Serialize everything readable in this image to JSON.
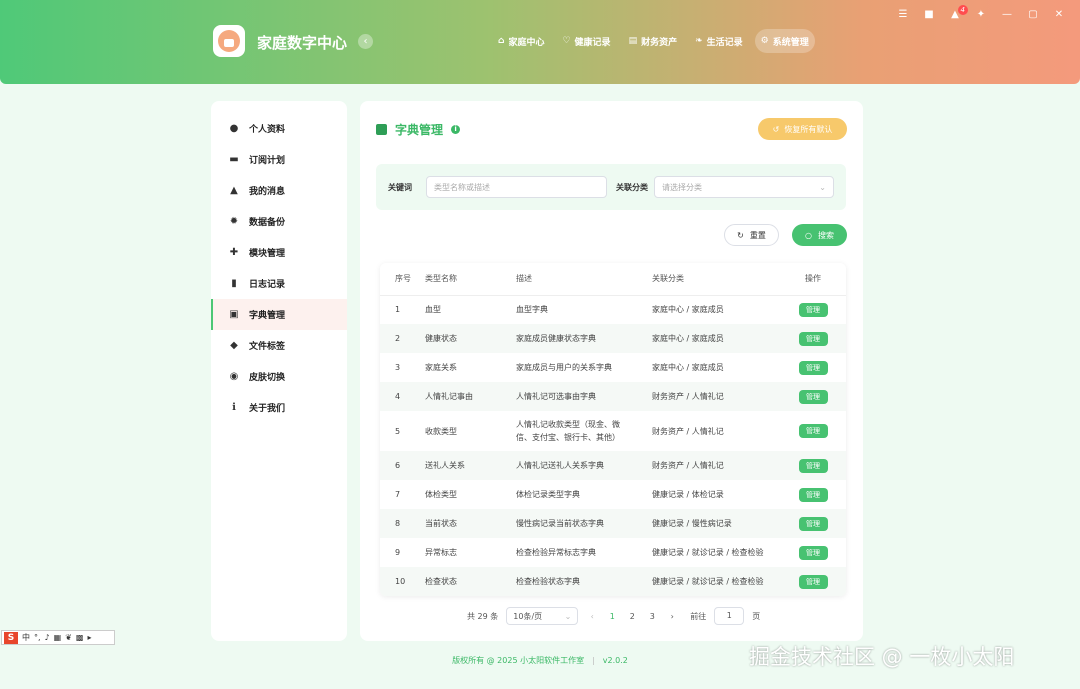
{
  "app": {
    "title": "家庭数字中心",
    "collapse_icon": "‹"
  },
  "nav": [
    {
      "label": "家庭中心",
      "icon": "home-icon"
    },
    {
      "label": "健康记录",
      "icon": "heart-icon"
    },
    {
      "label": "财务资产",
      "icon": "wallet-icon"
    },
    {
      "label": "生活记录",
      "icon": "leaf-icon"
    },
    {
      "label": "系统管理",
      "icon": "gears-icon",
      "active": true
    }
  ],
  "window": {
    "notification_count": "4"
  },
  "sidebar": [
    {
      "label": "个人资料",
      "icon": "user-icon"
    },
    {
      "label": "订阅计划",
      "icon": "card-icon"
    },
    {
      "label": "我的消息",
      "icon": "bell-icon"
    },
    {
      "label": "数据备份",
      "icon": "gear-icon"
    },
    {
      "label": "模块管理",
      "icon": "puzzle-icon"
    },
    {
      "label": "日志记录",
      "icon": "file-icon"
    },
    {
      "label": "字典管理",
      "icon": "book-icon",
      "active": true
    },
    {
      "label": "文件标签",
      "icon": "tag-icon"
    },
    {
      "label": "皮肤切换",
      "icon": "palette-icon"
    },
    {
      "label": "关于我们",
      "icon": "info-icon"
    }
  ],
  "page": {
    "title": "字典管理",
    "restore_label": "恢复所有默认",
    "filter": {
      "keyword_label": "关键词",
      "keyword_placeholder": "类型名称或描述",
      "category_label": "关联分类",
      "category_placeholder": "请选择分类"
    },
    "reset_label": "重置",
    "search_label": "搜索"
  },
  "table": {
    "headers": [
      "序号",
      "类型名称",
      "描述",
      "关联分类",
      "操作"
    ],
    "action_label": "管理",
    "rows": [
      {
        "no": "1",
        "name": "血型",
        "desc": "血型字典",
        "category": "家庭中心 / 家庭成员"
      },
      {
        "no": "2",
        "name": "健康状态",
        "desc": "家庭成员健康状态字典",
        "category": "家庭中心 / 家庭成员"
      },
      {
        "no": "3",
        "name": "家庭关系",
        "desc": "家庭成员与用户的关系字典",
        "category": "家庭中心 / 家庭成员"
      },
      {
        "no": "4",
        "name": "人情礼记事由",
        "desc": "人情礼记可选事由字典",
        "category": "财务资产 / 人情礼记"
      },
      {
        "no": "5",
        "name": "收款类型",
        "desc": "人情礼记收款类型（现金、微信、支付宝、银行卡、其他）",
        "category": "财务资产 / 人情礼记"
      },
      {
        "no": "6",
        "name": "送礼人关系",
        "desc": "人情礼记送礼人关系字典",
        "category": "财务资产 / 人情礼记"
      },
      {
        "no": "7",
        "name": "体检类型",
        "desc": "体检记录类型字典",
        "category": "健康记录 / 体检记录"
      },
      {
        "no": "8",
        "name": "当前状态",
        "desc": "慢性病记录当前状态字典",
        "category": "健康记录 / 慢性病记录"
      },
      {
        "no": "9",
        "name": "异常标志",
        "desc": "检查检验异常标志字典",
        "category": "健康记录 / 就诊记录 / 检查检验"
      },
      {
        "no": "10",
        "name": "检查状态",
        "desc": "检查检验状态字典",
        "category": "健康记录 / 就诊记录 / 检查检验"
      }
    ]
  },
  "pager": {
    "total": "共 29 条",
    "page_size": "10条/页",
    "pages": [
      "1",
      "2",
      "3"
    ],
    "current": "1",
    "goto_label": "前往",
    "goto_value": "1",
    "page_suffix": "页"
  },
  "footer": {
    "copyright": "版权所有 @ 2025 小太阳软件工作室",
    "version": "v2.0.2"
  },
  "ime": {
    "lang": "中"
  },
  "watermark": "掘金技术社区 @ 一枚小太阳",
  "colors": {
    "primary": "#47c271",
    "accent_orange": "#f7c96b",
    "header_start": "#4fc978",
    "header_end": "#f49a7c"
  }
}
